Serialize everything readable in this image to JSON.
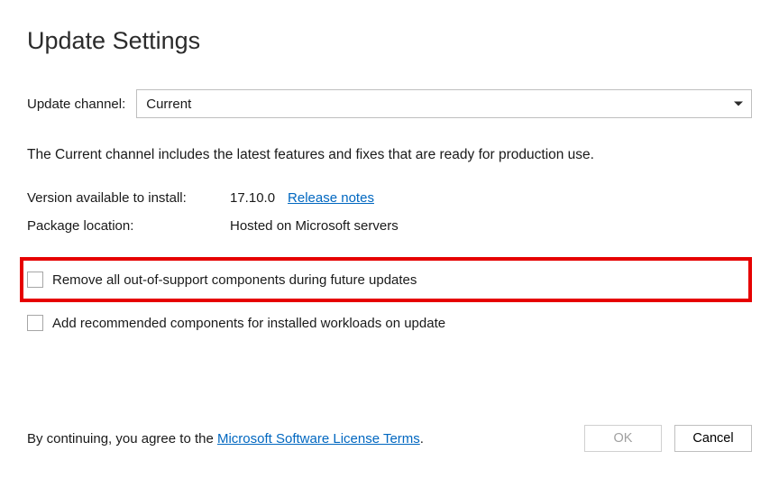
{
  "title": "Update Settings",
  "channel": {
    "label": "Update channel:",
    "value": "Current"
  },
  "description": "The Current channel includes the latest features and fixes that are ready for production use.",
  "info": {
    "version_label": "Version available to install:",
    "version_value": "17.10.0",
    "release_notes": "Release notes",
    "package_label": "Package location:",
    "package_value": "Hosted on Microsoft servers"
  },
  "checkboxes": {
    "remove_oos": "Remove all out-of-support components during future updates",
    "add_recommended": "Add recommended components for installed workloads on update"
  },
  "footer": {
    "agree_prefix": "By continuing, you agree to the ",
    "license_link": "Microsoft Software License Terms",
    "period": ".",
    "ok": "OK",
    "cancel": "Cancel"
  }
}
